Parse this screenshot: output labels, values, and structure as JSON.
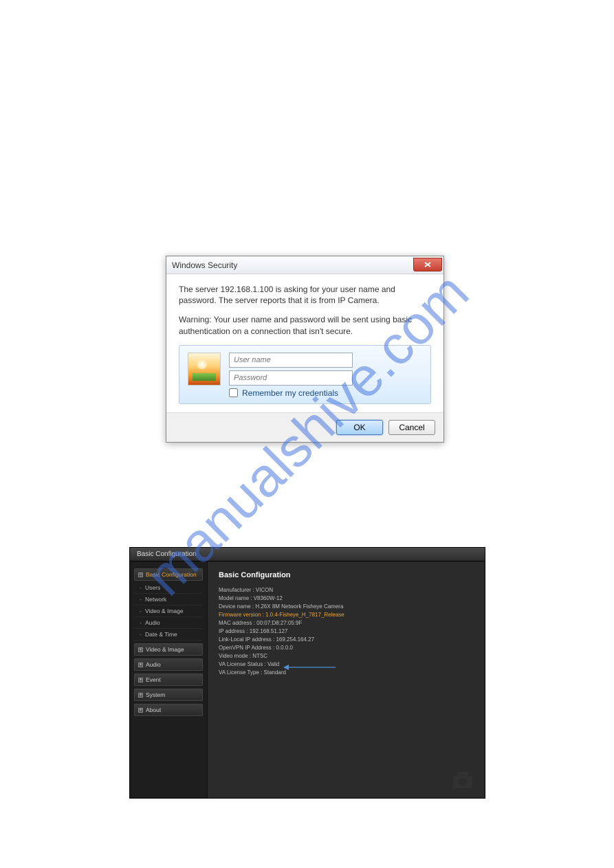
{
  "watermark": "manualshive.com",
  "winDialog": {
    "title": "Windows Security",
    "msg1": "The server 192.168.1.100 is asking for your user name and password. The server reports that it is from IP Camera.",
    "msg2": "Warning: Your user name and password will be sent using basic authentication on a connection that isn't secure.",
    "usernamePlaceholder": "User name",
    "passwordPlaceholder": "Password",
    "rememberLabel": "Remember my credentials",
    "okLabel": "OK",
    "cancelLabel": "Cancel"
  },
  "config": {
    "panelTitle": "Basic Configuration",
    "sidebar": {
      "basicConfig": "Basic Configuration",
      "items": [
        "Users",
        "Network",
        "Video & Image",
        "Audio",
        "Date & Time"
      ],
      "groups": [
        "Video & Image",
        "Audio",
        "Event",
        "System",
        "About"
      ]
    },
    "main": {
      "heading": "Basic Configuration",
      "lines": [
        "Manufacturer : VICON",
        "Model name : V8360W-12",
        "Device name : H.26X 8M Network Fisheye Camera",
        "Firmware version : 1.0.4-Fisheye_H_7817_Release",
        "MAC address : 00:07:D8:27:05:9F",
        "IP address : 192.168.51.127",
        "Link-Local IP address : 169.254.164.27",
        "OpenVPN IP Address : 0.0.0.0",
        "Video mode : NTSC",
        "VA License Status : Valid",
        "VA License Type : Standard"
      ],
      "highlightIndex": 3
    }
  }
}
